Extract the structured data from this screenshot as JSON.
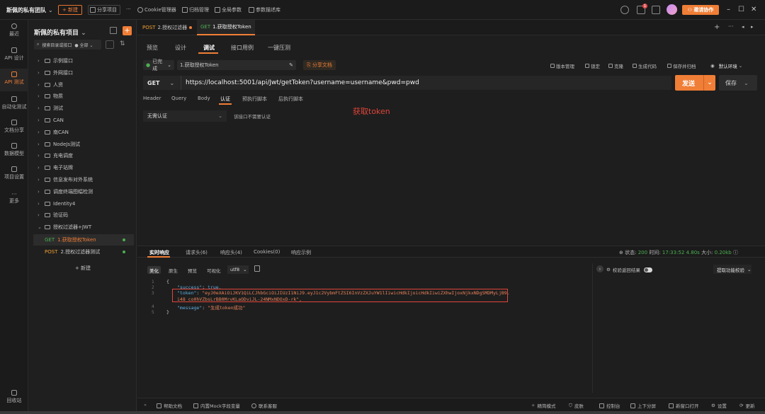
{
  "topbar": {
    "team": "斯佩的私有团队",
    "new_button": "+ 新建",
    "share_project": "分享项目",
    "more": "···",
    "cookie_manager": "Cookie管理器",
    "archive": "归档管理",
    "global_params": "全局参数",
    "param_description_lib": "参数描述库",
    "badge_count": "1",
    "invite_button": "邀请协作"
  },
  "rail": [
    {
      "label": "最近"
    },
    {
      "label": "API 设计"
    },
    {
      "label": "API 测试"
    },
    {
      "label": "自动化测试"
    },
    {
      "label": "文档分享"
    },
    {
      "label": "数据模型"
    },
    {
      "label": "项目设置"
    },
    {
      "label": "更多"
    },
    {
      "label": "回收站"
    }
  ],
  "tree": {
    "project_title": "斯佩的私有项目",
    "search_placeholder": "搜索目录或接口",
    "filter": "全部",
    "folders": [
      "示例接口",
      "外网接口",
      "人资",
      "物质",
      "测试",
      "CAN",
      "南CAN",
      "NodeJs测试",
      "充电调度",
      "电子站牌",
      "信息发布对外系统",
      "调度终端图幅检测",
      "Identity4",
      "验证码",
      "授权过滤器+JWT"
    ],
    "selected_leaf": {
      "method": "GET",
      "name": "1.获取授权Token"
    },
    "other_leaf": {
      "method": "POST",
      "name": "2.授权过滤器测试"
    },
    "new_label": "+ 新建"
  },
  "doc_tabs": [
    {
      "method": "POST",
      "name": "2.授权过滤器"
    },
    {
      "method": "GET",
      "name": "1.获取授权Token"
    }
  ],
  "sub_tabs": [
    "预览",
    "设计",
    "调试",
    "接口用例",
    "一键压测"
  ],
  "status": {
    "state": "已完成",
    "name": "1.获取授权Token",
    "share_doc": "分享文档",
    "actions": [
      "版本管理",
      "锁定",
      "克隆",
      "生成代码",
      "保存并归档"
    ],
    "env": "默认环境"
  },
  "request": {
    "method": "GET",
    "url": "https://localhost:5001/api/Jwt/getToken?username=username&pwd=pwd",
    "send": "发送",
    "save": "保存"
  },
  "param_tabs": [
    "Header",
    "Query",
    "Body",
    "认证",
    "预执行脚本",
    "后执行脚本"
  ],
  "auth": {
    "type": "无需认证",
    "note": "该接口不需要认证"
  },
  "annotation": "获取token",
  "response": {
    "tabs": [
      "实时响应",
      "请求头(6)",
      "响应头(4)",
      "Cookies(0)",
      "响应示例"
    ],
    "status_label": "状态:",
    "status_code": "200",
    "time_label": "时间:",
    "time": "17:33:52",
    "duration": "4.80s",
    "size_label": "大小:",
    "size": "0.20kb",
    "formats": [
      "美化",
      "原生",
      "预览",
      "可视化"
    ],
    "encoding": "utf8",
    "line_numbers": [
      "1",
      "2",
      "3",
      "",
      "4",
      "5"
    ],
    "json": {
      "open": "{",
      "success_key": "\"success\"",
      "success_val": "true,",
      "token_key": "\"token\"",
      "token_val_1": "\"eyJ0eXAiOiJKV1QiLCJhbGciOiJIUzI1NiJ9.eyJ1c2VybmFtZSI6InVzZXJuYW1lIiwicHdkIjoicHdkIiwiZXhwIjoxNjkxNDgSMDMyLjB9.",
      "token_val_2": "i48_co0hVZbsLrBB0MrvKLaODviJL-24NMxNDOxD-rk\",",
      "message_key": "\"message\"",
      "message_val": "\"生成token成功\"",
      "close": "}"
    },
    "check_label": "校验返回结果",
    "extract": "提取功能校验"
  },
  "footer": {
    "help": "帮助文档",
    "mock": "内置Mock字段变量",
    "contact": "联系客服",
    "mode": "精简模式",
    "skin": "皮肤",
    "console": "控制台",
    "split": "上下分屏",
    "new_window": "新窗口打开",
    "settings": "设置",
    "update": "更新"
  }
}
